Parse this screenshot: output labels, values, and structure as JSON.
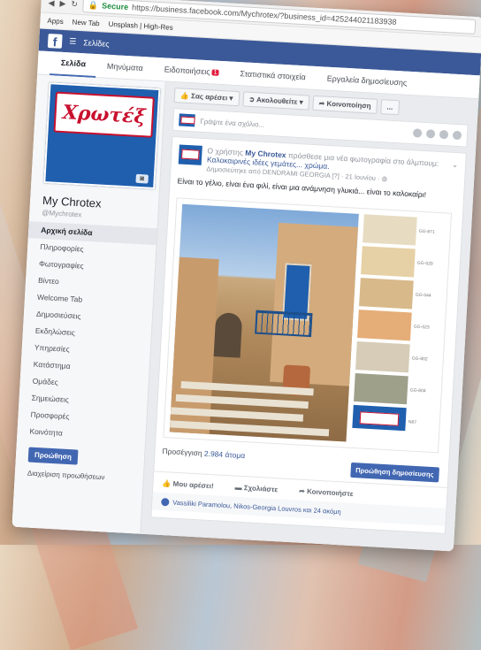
{
  "browser": {
    "secure_label": "Secure",
    "url": "https://business.facebook.com/Mychrotex/?business_id=425244021183938",
    "bookmarks": [
      "Apps",
      "New Tab",
      "Unsplash | High-Res"
    ]
  },
  "fb_header": {
    "menu_label": "Σελίδες"
  },
  "tabs": [
    {
      "label": "Σελίδα"
    },
    {
      "label": "Μηνύματα"
    },
    {
      "label": "Ειδοποιήσεις",
      "badge": "1"
    },
    {
      "label": "Στατιστικά στοιχεία"
    },
    {
      "label": "Εργαλεία δημοσίευσης"
    }
  ],
  "page": {
    "logo_text": "Χρωτέξ",
    "name": "My Chrotex",
    "username": "@Mychrotex"
  },
  "sidebar": {
    "items": [
      "Αρχική σελίδα",
      "Πληροφορίες",
      "Φωτογραφίες",
      "Βίντεο",
      "Welcome Tab",
      "Δημοσιεύσεις",
      "Εκδηλώσεις",
      "Υπηρεσίες",
      "Κατάστημα",
      "Ομάδες",
      "Σημειώσεις",
      "Προσφορές",
      "Κοινότητα"
    ],
    "promote_button": "Προώθηση",
    "manage_promotions": "Διαχείριση προωθήσεων"
  },
  "actions": {
    "like": "Σας αρέσει",
    "follow": "Ακολουθείτε",
    "share": "Κοινοποίηση",
    "more": "..."
  },
  "composer": {
    "placeholder": "Γράψτε ένα σχόλιο..."
  },
  "post": {
    "prefix": "Ο χρήστης",
    "author": "My Chrotex",
    "added": "πρόσθεσε μια νέα φωτογραφία στο άλμπουμ:",
    "album": "Καλοκαιρινές ιδέες γεμάτες... χρώμα.",
    "meta": "Δημοσιεύτηκε από DENDRAMI GEORGIA [?] · 21 Ιουνίου · ",
    "text": "Είναι το γέλιο, είναι ένα φιλί, είναι μια ανάμνηση γλυκιά... είναι το καλοκαίρι!",
    "swatches": [
      {
        "code": "GG-871",
        "color": "#e7dcc2"
      },
      {
        "code": "GG-529",
        "color": "#e6d0a5"
      },
      {
        "code": "GG-544",
        "color": "#d8b98a"
      },
      {
        "code": "GG-523",
        "color": "#e5ad78"
      },
      {
        "code": "GG-802",
        "color": "#d6ccb7"
      },
      {
        "code": "GG-804",
        "color": "#9ea08a"
      },
      {
        "code": "N87",
        "color": "#1f5fae"
      }
    ],
    "reach_label": "Προσέγγιση",
    "reach_value": "2.984 άτομα",
    "boost_button": "Προώθηση δημοσίευσης",
    "like_action": "Μου αρέσει!",
    "comment_action": "Σχολιάστε",
    "share_action": "Κοινοποιήστε",
    "likers": "Vassiliki Paramolou, Nikos-Georgia Louvros και 24 ακόμη"
  },
  "colors": {
    "facebook_blue": "#3b5998",
    "brand_red": "#c8102e",
    "brand_blue": "#1f5fae"
  }
}
